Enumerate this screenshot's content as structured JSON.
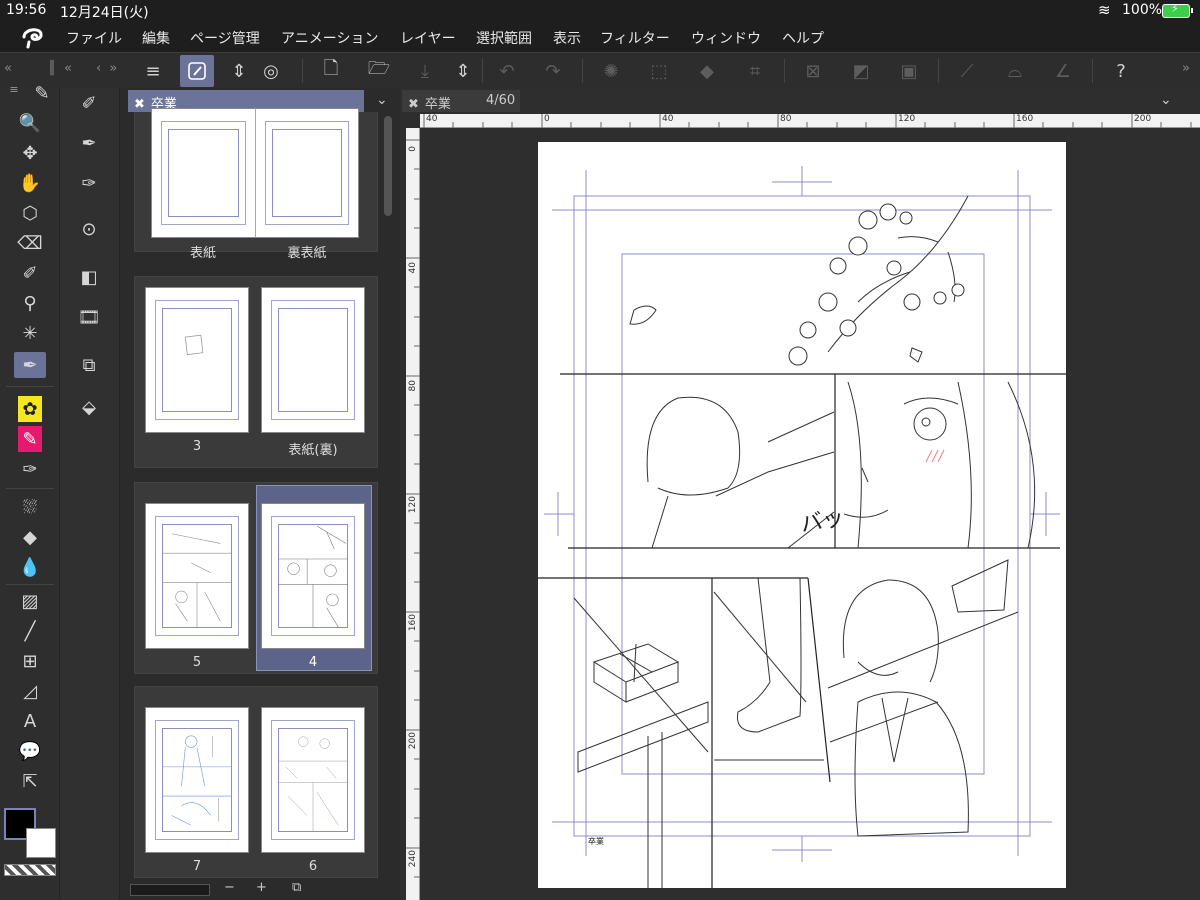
{
  "status": {
    "time": "19:56",
    "date": "12月24日(火)",
    "battery_pct": "100%"
  },
  "menu": [
    "ファイル",
    "編集",
    "ページ管理",
    "アニメーション",
    "レイヤー",
    "選択範囲",
    "表示",
    "フィルター",
    "ウィンドウ",
    "ヘルプ"
  ],
  "toolbar": {
    "icons": [
      "menu-icon",
      "pen-settings-icon",
      "chevron-updown-icon",
      "spiral-icon",
      "new-file-icon",
      "open-folder-icon",
      "save-icon",
      "chevron-updown-icon",
      "undo-icon",
      "redo-icon",
      "loading-icon",
      "select-area-icon",
      "fill-icon",
      "transform-icon",
      "deselect-icon",
      "invert-selection-icon",
      "crop-icon",
      "brush-icon",
      "fill-bucket-icon",
      "pen-line-icon",
      "help-icon"
    ]
  },
  "page_manager": {
    "tab_label": "卒業",
    "spreads": [
      {
        "left": "表紙",
        "right": "裏表紙"
      },
      {
        "left": "3",
        "right": "表紙(裏)"
      },
      {
        "left": "5",
        "right": "4",
        "selected": "right"
      },
      {
        "left": "7",
        "right": "6"
      }
    ],
    "bottom": {
      "minus": "−",
      "plus": "+"
    }
  },
  "canvas": {
    "tab_label": "卒業",
    "page_indicator": "4/60",
    "ruler_h": [
      "40",
      "0",
      "40",
      "80",
      "120",
      "160",
      "200"
    ],
    "ruler_v": [
      "0",
      "40",
      "80",
      "120",
      "160",
      "200",
      "240"
    ],
    "manga_sfx": "バッ",
    "page_note": "卒業"
  }
}
